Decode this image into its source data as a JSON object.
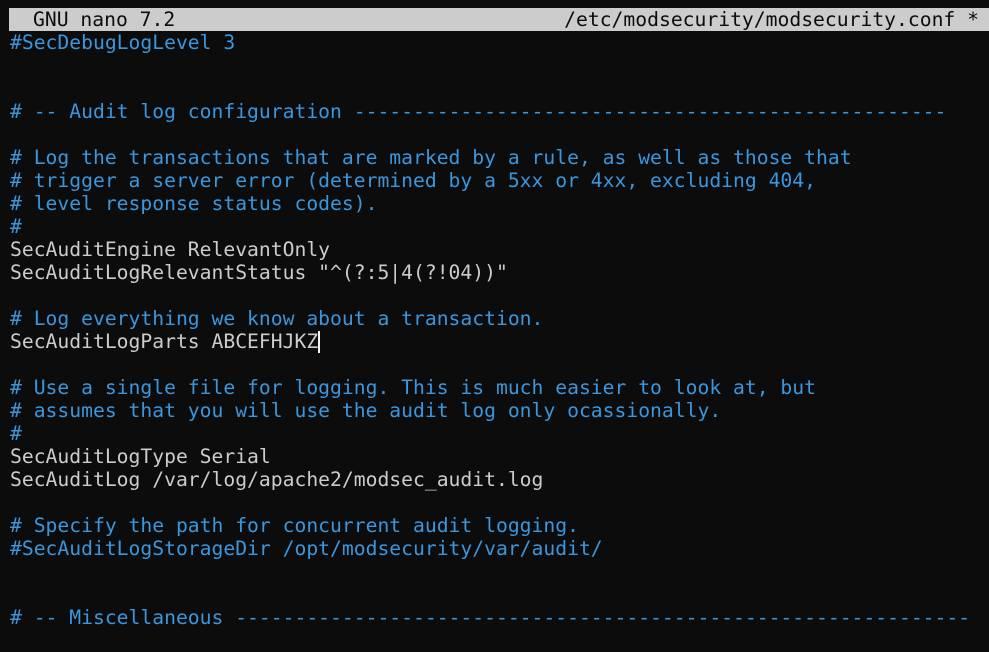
{
  "titlebar": {
    "app_name": "GNU nano 7.2",
    "file_name": "/etc/modsecurity/modsecurity.conf *"
  },
  "colors": {
    "background": "#0c0c0c",
    "foreground": "#cccccc",
    "comment": "#3a96dd",
    "titlebar_bg": "#cccccc",
    "titlebar_fg": "#0c0c0c"
  },
  "editor": {
    "lines": [
      {
        "type": "comment",
        "text": "#SecDebugLogLevel 3"
      },
      {
        "type": "blank",
        "text": ""
      },
      {
        "type": "blank",
        "text": ""
      },
      {
        "type": "comment",
        "text": "# -- Audit log configuration --------------------------------------------------"
      },
      {
        "type": "blank",
        "text": ""
      },
      {
        "type": "comment",
        "text": "# Log the transactions that are marked by a rule, as well as those that"
      },
      {
        "type": "comment",
        "text": "# trigger a server error (determined by a 5xx or 4xx, excluding 404,"
      },
      {
        "type": "comment",
        "text": "# level response status codes)."
      },
      {
        "type": "comment",
        "text": "#"
      },
      {
        "type": "directive",
        "text": "SecAuditEngine RelevantOnly"
      },
      {
        "type": "directive",
        "text": "SecAuditLogRelevantStatus \"^(?:5|4(?!04))\""
      },
      {
        "type": "blank",
        "text": ""
      },
      {
        "type": "comment",
        "text": "# Log everything we know about a transaction."
      },
      {
        "type": "directive",
        "text": "SecAuditLogParts ABCEFHJKZ",
        "cursor": true
      },
      {
        "type": "blank",
        "text": ""
      },
      {
        "type": "comment",
        "text": "# Use a single file for logging. This is much easier to look at, but"
      },
      {
        "type": "comment",
        "text": "# assumes that you will use the audit log only ocassionally."
      },
      {
        "type": "comment",
        "text": "#"
      },
      {
        "type": "directive",
        "text": "SecAuditLogType Serial"
      },
      {
        "type": "directive",
        "text": "SecAuditLog /var/log/apache2/modsec_audit.log"
      },
      {
        "type": "blank",
        "text": ""
      },
      {
        "type": "comment",
        "text": "# Specify the path for concurrent audit logging."
      },
      {
        "type": "comment",
        "text": "#SecAuditLogStorageDir /opt/modsecurity/var/audit/"
      },
      {
        "type": "blank",
        "text": ""
      },
      {
        "type": "blank",
        "text": ""
      },
      {
        "type": "comment",
        "text": "# -- Miscellaneous --------------------------------------------------------------"
      }
    ]
  }
}
